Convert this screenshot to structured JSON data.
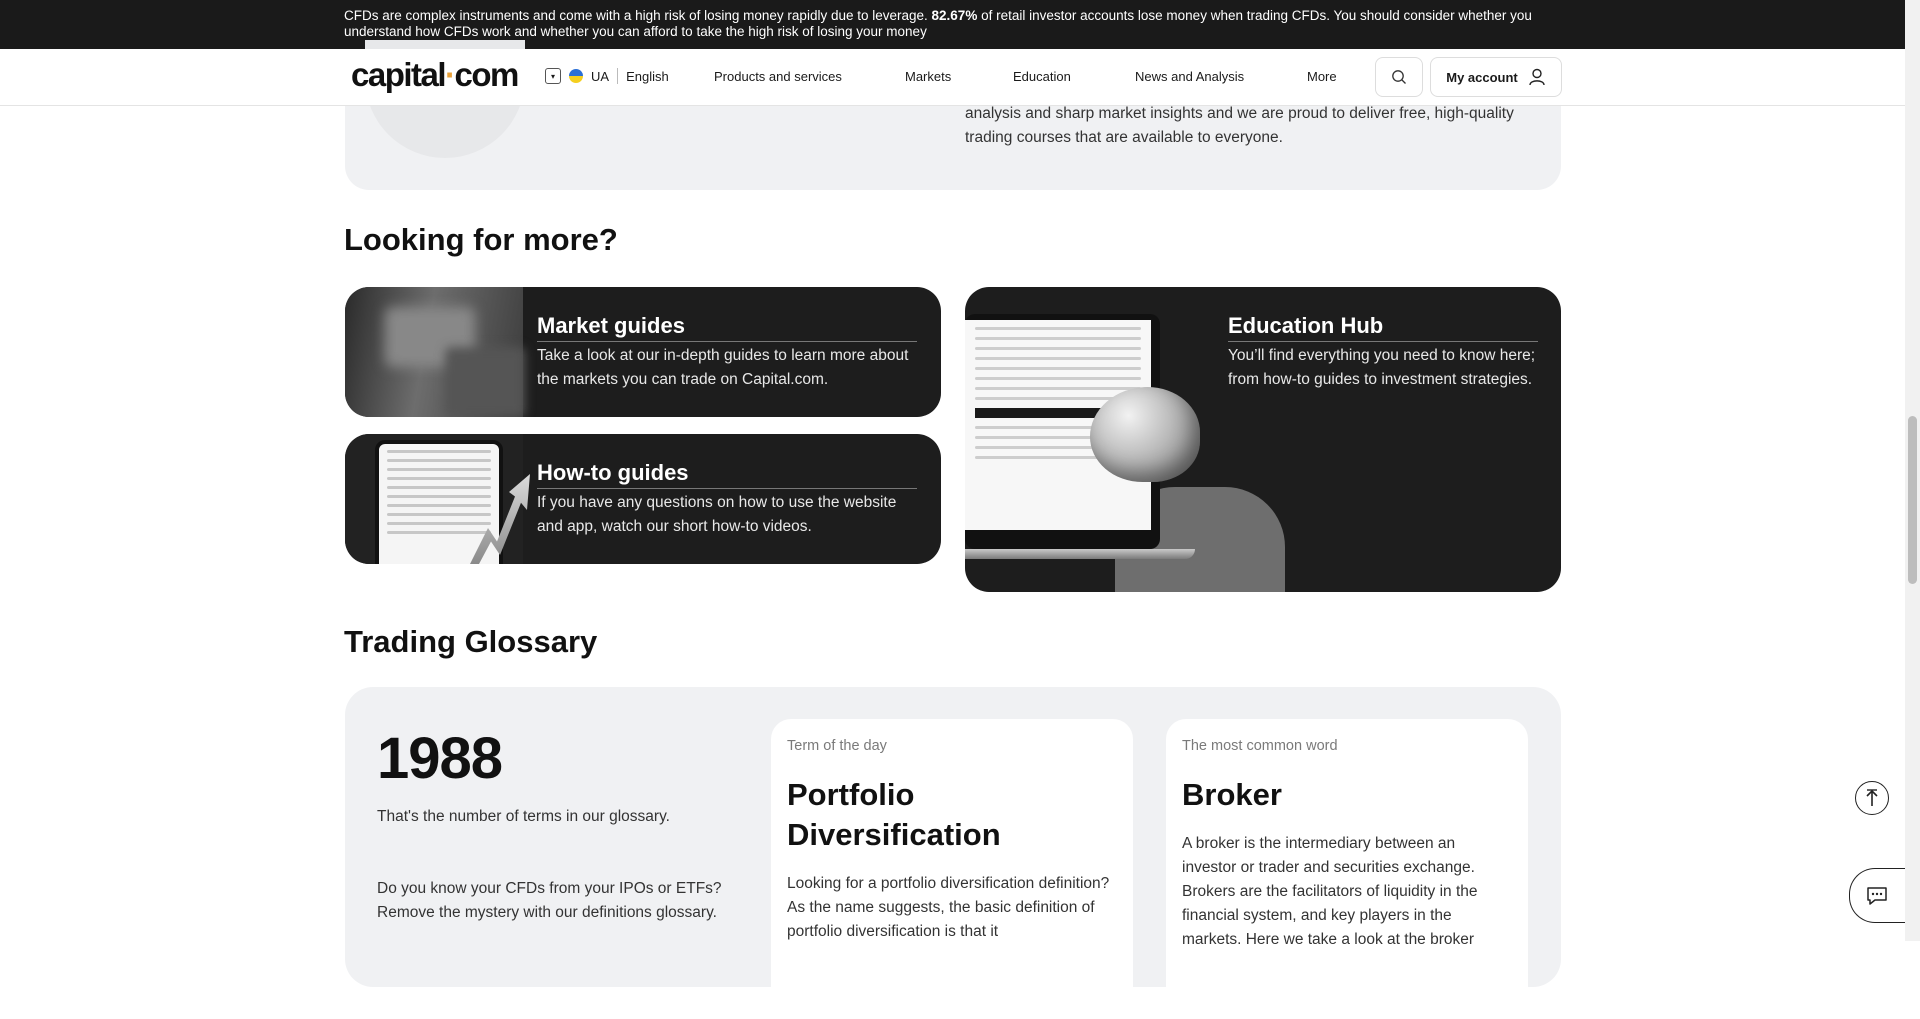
{
  "risk_banner": {
    "text_before": "CFDs are complex instruments and come with a high risk of losing money rapidly due to leverage. ",
    "percent": "82.67%",
    "text_after": " of retail investor accounts lose money when trading CFDs. You should consider whether you understand how CFDs work and whether you can afford to take the high risk of losing your money"
  },
  "header": {
    "logo_left": "capital",
    "logo_dot": "·",
    "logo_right": "com",
    "region": "UA",
    "language": "English",
    "nav": [
      "Products and services",
      "Markets",
      "Education",
      "News and Analysis",
      "More"
    ],
    "account_label": "My account"
  },
  "intro_card": {
    "text": "analysis and sharp market insights and we are proud to deliver free, high-quality trading courses that are available to everyone."
  },
  "looking_for_more": {
    "heading": "Looking for more?",
    "cards": [
      {
        "title": "Market guides",
        "desc": "Take a look at our in-depth guides to learn more about the markets you can trade on Capital.com."
      },
      {
        "title": "How-to guides",
        "desc": "If you have any questions on how to use the website and app, watch our short how-to videos."
      },
      {
        "title": "Education Hub",
        "desc": "You’ll find everything you need to know here; from how-to guides to investment strategies."
      }
    ]
  },
  "glossary": {
    "heading": "Trading Glossary",
    "count": "1988",
    "count_desc": "That's the number of terms in our glossary.",
    "intro": "Do you know your CFDs from your IPOs or ETFs? Remove the mystery with our definitions glossary.",
    "term_of_day": {
      "label": "Term of the day",
      "term": "Portfolio Diversification",
      "body": "Looking for a portfolio diversification definition? As the name suggests, the basic definition of portfolio diversification is that it"
    },
    "common_word": {
      "label": "The most common word",
      "term": "Broker",
      "body": "A broker is the intermediary between an investor or trader and securities exchange. Brokers are the facilitators of liquidity in the financial system, and key players in the markets. Here we take a look at the broker"
    }
  },
  "colors": {
    "accent": "#e8a13a",
    "dark_card": "#1d1d1d",
    "panel": "#f0f1f3",
    "banner": "#1a1a1a"
  }
}
